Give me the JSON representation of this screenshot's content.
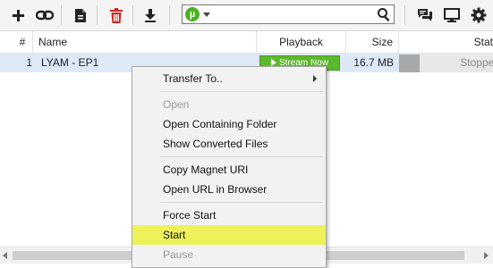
{
  "toolbar": {
    "buttons": [
      "add-torrent",
      "add-url",
      "create-torrent",
      "remove",
      "download"
    ],
    "search_value": "",
    "right_buttons": [
      "chat",
      "remote",
      "preferences"
    ]
  },
  "table": {
    "columns": [
      "#",
      "Name",
      "Playback",
      "Size",
      "Stat"
    ],
    "rows": [
      {
        "index": "1",
        "name": "LYAM - EP1",
        "playback": "Stream Now",
        "size": "16.7 MB",
        "status": "Stopped"
      }
    ]
  },
  "context_menu": {
    "items": [
      {
        "label": "Transfer To..",
        "disabled": false,
        "submenu": true
      },
      {
        "label": "Open",
        "disabled": true
      },
      {
        "label": "Open Containing Folder",
        "disabled": false
      },
      {
        "label": "Show Converted Files",
        "disabled": false
      },
      {
        "label": "Copy Magnet URI",
        "disabled": false
      },
      {
        "label": "Open URL in Browser",
        "disabled": false
      },
      {
        "label": "Force Start",
        "disabled": false
      },
      {
        "label": "Start",
        "disabled": false,
        "highlighted": true
      },
      {
        "label": "Pause",
        "disabled": true
      }
    ]
  },
  "colors": {
    "highlight": "#eef25a",
    "selected_row": "#dde9f7",
    "stream_button": "#5cb82c",
    "delete_icon": "#c62828",
    "utorrent_logo": "#4caf22"
  }
}
